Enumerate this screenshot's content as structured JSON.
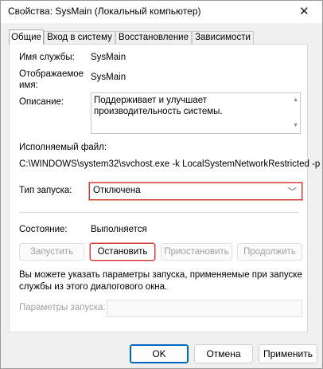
{
  "window": {
    "title": "Свойства: SysMain (Локальный компьютер)",
    "close_glyph": "✕"
  },
  "tabs": [
    {
      "label": "Общие",
      "active": true
    },
    {
      "label": "Вход в систему",
      "active": false
    },
    {
      "label": "Восстановление",
      "active": false
    },
    {
      "label": "Зависимости",
      "active": false
    }
  ],
  "general": {
    "service_name_label": "Имя службы:",
    "service_name_value": "SysMain",
    "display_name_label_line1": "Отображаемое",
    "display_name_label_line2": "имя:",
    "display_name_value": "SysMain",
    "description_label": "Описание:",
    "description_value": "Поддерживает и улучшает производительность системы.",
    "executable_label": "Исполняемый файл:",
    "executable_value": "C:\\WINDOWS\\system32\\svchost.exe -k LocalSystemNetworkRestricted -p",
    "startup_type_label": "Тип запуска:",
    "startup_type_value": "Отключена",
    "status_label": "Состояние:",
    "status_value": "Выполняется"
  },
  "service_buttons": {
    "start": "Запустить",
    "stop": "Остановить",
    "pause": "Приостановить",
    "resume": "Продолжить"
  },
  "hint_line1": "Вы можете указать параметры запуска, применяемые при запуске",
  "hint_line2": "службы из этого диалогового окна.",
  "params": {
    "label": "Параметры запуска:",
    "value": ""
  },
  "footer": {
    "ok": "OK",
    "cancel": "Отмена",
    "apply": "Применить"
  },
  "colors": {
    "highlight": "#d23b3b",
    "ok_border": "#0067c0",
    "disabled_text": "#a0a0a0"
  }
}
